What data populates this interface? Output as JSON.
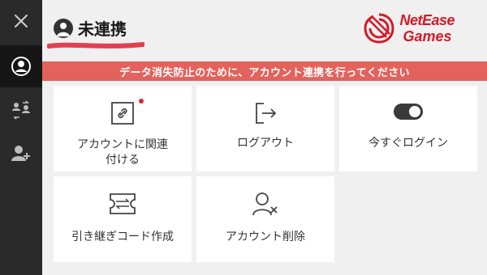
{
  "sidebar": {
    "items": [
      {
        "name": "close"
      },
      {
        "name": "account",
        "active": true
      },
      {
        "name": "switch-users"
      },
      {
        "name": "add-user"
      }
    ]
  },
  "header": {
    "status_text": "未連携",
    "brand": {
      "line1": "NetEase",
      "line2": "Games",
      "color": "#d31a26"
    }
  },
  "banner": {
    "text": "データ消失防止のために、アカウント連携を行ってください",
    "color": "#e3625c"
  },
  "tiles": [
    {
      "label": "アカウントに関連\n付ける",
      "icon": "link-icon",
      "badge": true
    },
    {
      "label": "ログアウト",
      "icon": "logout-icon"
    },
    {
      "label": "今すぐログイン",
      "icon": "toggle-icon"
    },
    {
      "label": "引き継ぎコード作成",
      "icon": "ticket-icon"
    },
    {
      "label": "アカウント削除",
      "icon": "user-remove-icon"
    }
  ]
}
